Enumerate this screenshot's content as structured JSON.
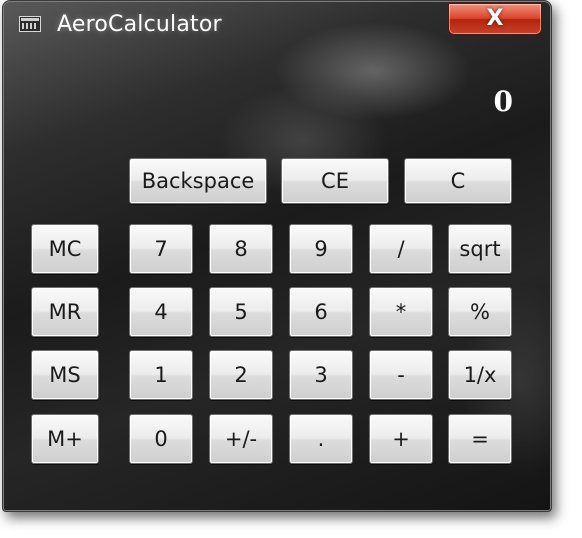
{
  "window": {
    "title": "AeroCalculator",
    "icon": "calculator-icon",
    "close_label": "X"
  },
  "display": {
    "value": "0"
  },
  "buttons": {
    "backspace": "Backspace",
    "ce": "CE",
    "c": "C",
    "mc": "MC",
    "mr": "MR",
    "ms": "MS",
    "mplus": "M+",
    "d7": "7",
    "d8": "8",
    "d9": "9",
    "divide": "/",
    "sqrt": "sqrt",
    "d4": "4",
    "d5": "5",
    "d6": "6",
    "multiply": "*",
    "percent": "%",
    "d1": "1",
    "d2": "2",
    "d3": "3",
    "minus": "-",
    "reciprocal": "1/x",
    "d0": "0",
    "plusminus": "+/-",
    "decimal": ".",
    "plus": "+",
    "equals": "="
  },
  "colors": {
    "close_button": "#d9452c",
    "window_background": "#1b1b1b",
    "button_face": "#ececec"
  }
}
